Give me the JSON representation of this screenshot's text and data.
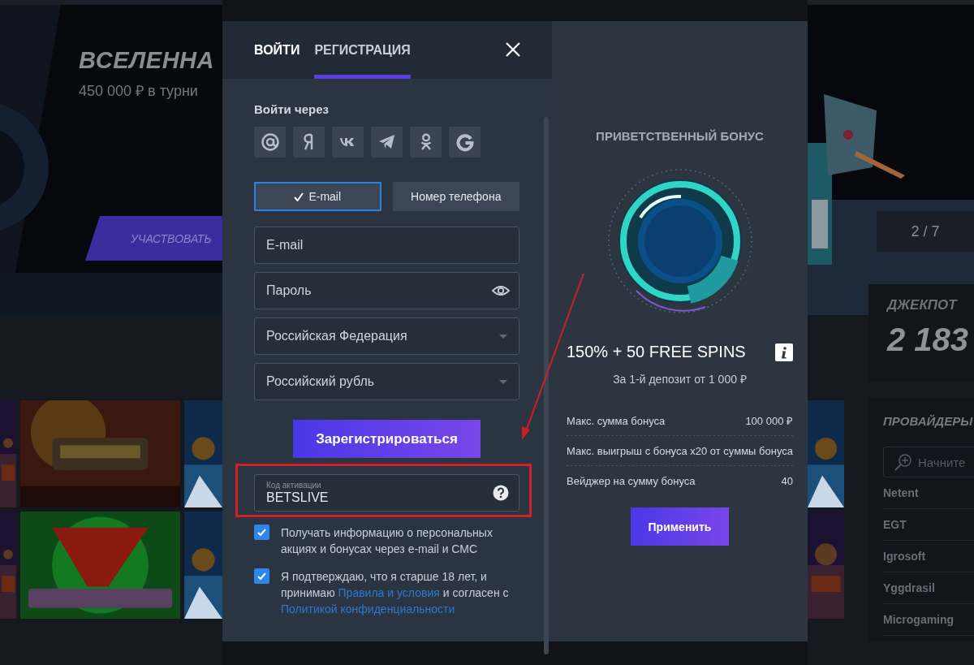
{
  "background": {
    "banner": {
      "title": "ВСЕЛЕННА",
      "subtitle": "450 000 ₽ в турни",
      "button": "УЧАСТВОВАТЬ",
      "slide_counter": "2 / 7"
    },
    "jackpot": {
      "label": "ДЖЕКПОТ",
      "amount": "2 183"
    },
    "providers": {
      "title": "ПРОВАЙДЕРЫ",
      "search_placeholder": "Начните",
      "items": [
        "Netent",
        "EGT",
        "Igrosoft",
        "Yggdrasil",
        "Microgaming"
      ]
    }
  },
  "modal": {
    "tabs": [
      {
        "label": "ВОЙТИ",
        "selected": false
      },
      {
        "label": "РЕГИСТРАЦИЯ",
        "selected": true
      }
    ],
    "social_login": {
      "label": "Войти через",
      "providers": [
        {
          "kind": "mail"
        },
        {
          "kind": "yandex"
        },
        {
          "kind": "vk"
        },
        {
          "kind": "telegram"
        },
        {
          "kind": "ok"
        },
        {
          "kind": "google"
        }
      ]
    },
    "method_toggle": [
      {
        "label": "E-mail",
        "selected": true
      },
      {
        "label": "Номер телефона",
        "selected": false
      }
    ],
    "fields": [
      {
        "kind": "text",
        "placeholder": "E-mail"
      },
      {
        "kind": "password",
        "placeholder": "Пароль"
      },
      {
        "kind": "select",
        "value": "Российская Федерация"
      },
      {
        "kind": "select",
        "value": "Российский рубль"
      }
    ],
    "register_button": "Зарегистрироваться",
    "activation_code": {
      "label": "Код активации",
      "value": "BETSLIVE"
    },
    "checkboxes": [
      {
        "checked": true,
        "parts": [
          {
            "kind": "text",
            "text": "Получать информацию о персональных акциях и бонусах через e-mail и СМС"
          }
        ]
      },
      {
        "checked": true,
        "parts": [
          {
            "kind": "text",
            "text": "Я подтверждаю, что я старше 18 лет, и принимаю "
          },
          {
            "kind": "link",
            "text": "Правила и условия"
          },
          {
            "kind": "text",
            "text": " и согласен с "
          },
          {
            "kind": "link",
            "text": "Политикой конфиденциальности"
          }
        ]
      }
    ]
  },
  "bonus": {
    "title": "ПРИВЕТСТВЕННЫЙ БОНУС",
    "headline": "150% + 50 FREE SPINS",
    "subtitle": "За 1-й депозит от 1 000 ₽",
    "details": [
      {
        "label": "Макс. сумма бонуса",
        "value": "100 000 ₽"
      },
      {
        "label": "Макс. выигрыш с бонуса",
        "value": "x20 от суммы бонуса"
      },
      {
        "label": "Вейджер на сумму бонуса",
        "value": "40"
      }
    ],
    "apply_button": "Применить"
  }
}
